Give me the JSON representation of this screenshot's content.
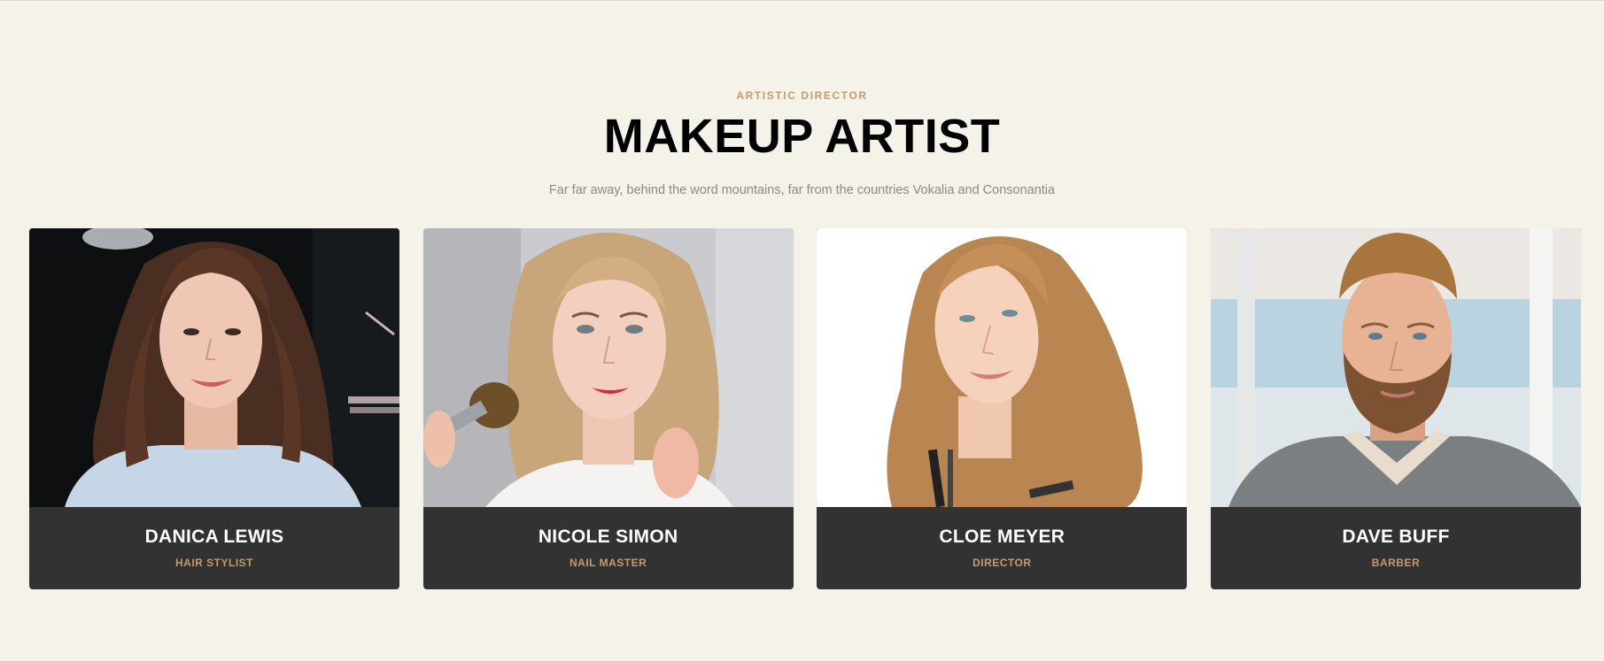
{
  "section": {
    "subheading": "ARTISTIC DIRECTOR",
    "title": "MAKEUP ARTIST",
    "lead": "Far far away, behind the word mountains, far from the countries Vokalia and Consonantia"
  },
  "team": [
    {
      "name": "DANICA LEWIS",
      "role": "HAIR STYLIST",
      "photo_alt": "portrait-woman-dark-hair"
    },
    {
      "name": "NICOLE SIMON",
      "role": "NAIL MASTER",
      "photo_alt": "portrait-woman-blonde-brush"
    },
    {
      "name": "CLOE MEYER",
      "role": "DIRECTOR",
      "photo_alt": "portrait-woman-auburn-comb"
    },
    {
      "name": "DAVE BUFF",
      "role": "BARBER",
      "photo_alt": "portrait-man-beard"
    }
  ],
  "colors": {
    "background": "#f5f2ea",
    "accent": "#c49a6c",
    "card_footer": "#323232"
  }
}
